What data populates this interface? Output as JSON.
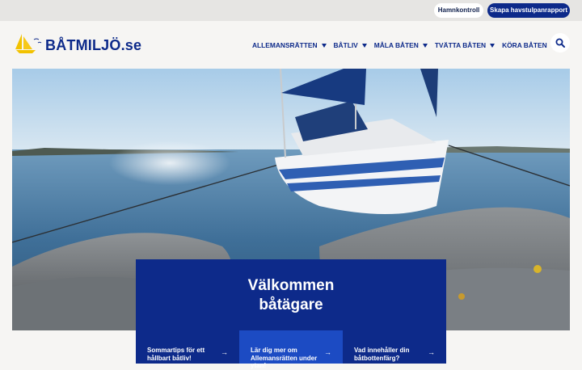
{
  "topbar": {
    "link_light": "Hamnkontroll",
    "link_dark": "Skapa havstulpanrapport"
  },
  "header": {
    "logo_text": "BÅTMILJÖ.se",
    "nav": [
      {
        "label": "ALLEMANSRÄTTEN"
      },
      {
        "label": "BÅTLIV"
      },
      {
        "label": "MÅLA BÅTEN"
      },
      {
        "label": "TVÄTTA BÅTEN"
      },
      {
        "label": "KÖRA BÅTEN"
      }
    ],
    "search_icon": "search-icon"
  },
  "hero": {
    "welcome_line1": "Välkommen",
    "welcome_line2": "båtägare"
  },
  "cards": [
    {
      "text": "Sommartips för ett hållbart båtliv!",
      "arrow": "→"
    },
    {
      "text": "Lär dig mer om Allemansrätten under ytan!",
      "arrow": "→"
    },
    {
      "text": "Vad innehåller din båtbottenfärg?",
      "arrow": "→"
    }
  ],
  "colors": {
    "brand_blue": "#0d2a8a",
    "accent_blue": "#1c4bc3",
    "logo_yellow": "#f2c200"
  }
}
